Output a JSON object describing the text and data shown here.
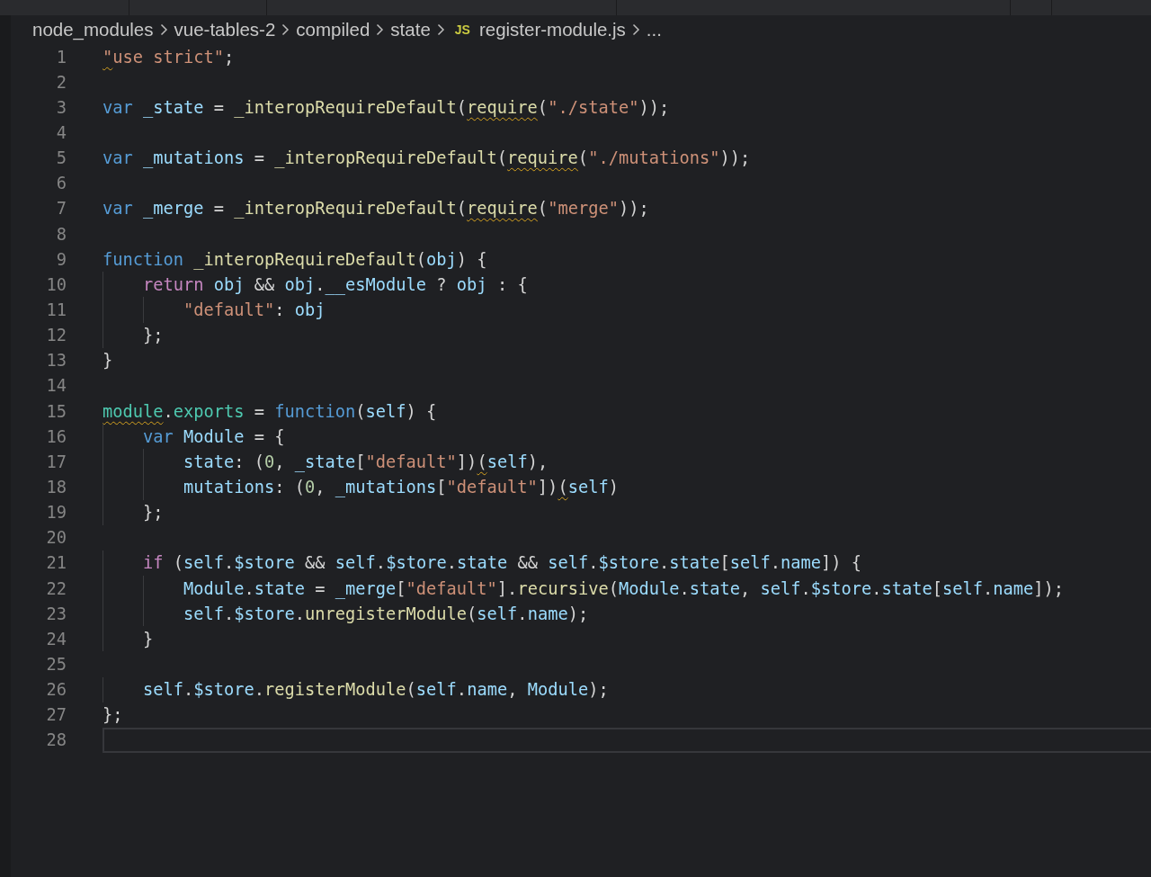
{
  "breadcrumbs": [
    {
      "kind": "folder",
      "label": "node_modules"
    },
    {
      "kind": "folder",
      "label": "vue-tables-2"
    },
    {
      "kind": "folder",
      "label": "compiled"
    },
    {
      "kind": "folder",
      "label": "state"
    },
    {
      "kind": "file",
      "badge": "JS",
      "label": "register-module.js"
    },
    {
      "kind": "more",
      "label": "..."
    }
  ],
  "lines": [
    {
      "number": "1",
      "current": false,
      "tokens": [
        {
          "text": "\"",
          "kind": "str",
          "warn": true
        },
        {
          "text": "use strict\"",
          "kind": "str"
        },
        {
          "text": ";",
          "kind": "punc"
        }
      ]
    },
    {
      "number": "2",
      "current": false
    },
    {
      "number": "3",
      "current": false,
      "tokens": [
        {
          "text": "var ",
          "kind": "kw"
        },
        {
          "text": "_state",
          "kind": "var"
        },
        {
          "text": " = ",
          "kind": "punc"
        },
        {
          "text": "_interopRequireDefault",
          "kind": "fn"
        },
        {
          "text": "(",
          "kind": "punc"
        },
        {
          "text": "require",
          "kind": "fn",
          "warn": true
        },
        {
          "text": "(",
          "kind": "punc"
        },
        {
          "text": "\"./state\"",
          "kind": "str"
        },
        {
          "text": "));",
          "kind": "punc"
        }
      ]
    },
    {
      "number": "4",
      "current": false
    },
    {
      "number": "5",
      "current": false,
      "tokens": [
        {
          "text": "var ",
          "kind": "kw"
        },
        {
          "text": "_mutations",
          "kind": "var"
        },
        {
          "text": " = ",
          "kind": "punc"
        },
        {
          "text": "_interopRequireDefault",
          "kind": "fn"
        },
        {
          "text": "(",
          "kind": "punc"
        },
        {
          "text": "require",
          "kind": "fn",
          "warn": true
        },
        {
          "text": "(",
          "kind": "punc"
        },
        {
          "text": "\"./mutations\"",
          "kind": "str"
        },
        {
          "text": "));",
          "kind": "punc"
        }
      ]
    },
    {
      "number": "6",
      "current": false
    },
    {
      "number": "7",
      "current": false,
      "tokens": [
        {
          "text": "var ",
          "kind": "kw"
        },
        {
          "text": "_merge",
          "kind": "var"
        },
        {
          "text": " = ",
          "kind": "punc"
        },
        {
          "text": "_interopRequireDefault",
          "kind": "fn"
        },
        {
          "text": "(",
          "kind": "punc"
        },
        {
          "text": "require",
          "kind": "fn",
          "warn": true
        },
        {
          "text": "(",
          "kind": "punc"
        },
        {
          "text": "\"merge\"",
          "kind": "str"
        },
        {
          "text": "));",
          "kind": "punc"
        }
      ]
    },
    {
      "number": "8",
      "current": false
    },
    {
      "number": "9",
      "current": false,
      "tokens": [
        {
          "text": "function ",
          "kind": "kw"
        },
        {
          "text": "_interopRequireDefault",
          "kind": "fn"
        },
        {
          "text": "(",
          "kind": "punc"
        },
        {
          "text": "obj",
          "kind": "var"
        },
        {
          "text": ") {",
          "kind": "punc"
        }
      ]
    },
    {
      "number": "10",
      "current": false,
      "tokens": [
        {
          "text": "    return ",
          "kind": "ctl"
        },
        {
          "text": "obj",
          "kind": "var"
        },
        {
          "text": " && ",
          "kind": "punc"
        },
        {
          "text": "obj",
          "kind": "var"
        },
        {
          "text": ".",
          "kind": "punc"
        },
        {
          "text": "__esModule",
          "kind": "var"
        },
        {
          "text": " ? ",
          "kind": "punc"
        },
        {
          "text": "obj",
          "kind": "var"
        },
        {
          "text": " : {",
          "kind": "punc"
        }
      ]
    },
    {
      "number": "11",
      "current": false,
      "tokens": [
        {
          "text": "        \"default\"",
          "kind": "str"
        },
        {
          "text": ": ",
          "kind": "punc"
        },
        {
          "text": "obj",
          "kind": "var"
        }
      ]
    },
    {
      "number": "12",
      "current": false,
      "tokens": [
        {
          "text": "    };",
          "kind": "punc"
        }
      ]
    },
    {
      "number": "13",
      "current": false,
      "tokens": [
        {
          "text": "}",
          "kind": "punc"
        }
      ]
    },
    {
      "number": "14",
      "current": false
    },
    {
      "number": "15",
      "current": false,
      "tokens": [
        {
          "text": "module",
          "kind": "type",
          "warn": true
        },
        {
          "text": ".",
          "kind": "punc"
        },
        {
          "text": "exports",
          "kind": "type"
        },
        {
          "text": " = ",
          "kind": "punc"
        },
        {
          "text": "function",
          "kind": "kw"
        },
        {
          "text": "(",
          "kind": "punc"
        },
        {
          "text": "self",
          "kind": "var"
        },
        {
          "text": ") {",
          "kind": "punc"
        }
      ]
    },
    {
      "number": "16",
      "current": false,
      "tokens": [
        {
          "text": "    var ",
          "kind": "kw"
        },
        {
          "text": "Module",
          "kind": "var"
        },
        {
          "text": " = {",
          "kind": "punc"
        }
      ]
    },
    {
      "number": "17",
      "current": false,
      "tokens": [
        {
          "text": "        state",
          "kind": "var"
        },
        {
          "text": ": (",
          "kind": "punc"
        },
        {
          "text": "0",
          "kind": "num"
        },
        {
          "text": ", ",
          "kind": "punc"
        },
        {
          "text": "_state",
          "kind": "var"
        },
        {
          "text": "[",
          "kind": "punc"
        },
        {
          "text": "\"default\"",
          "kind": "str"
        },
        {
          "text": "])",
          "kind": "punc"
        },
        {
          "text": "(",
          "kind": "punc",
          "warn": true
        },
        {
          "text": "self",
          "kind": "var"
        },
        {
          "text": "),",
          "kind": "punc"
        }
      ]
    },
    {
      "number": "18",
      "current": false,
      "tokens": [
        {
          "text": "        mutations",
          "kind": "var"
        },
        {
          "text": ": (",
          "kind": "punc"
        },
        {
          "text": "0",
          "kind": "num"
        },
        {
          "text": ", ",
          "kind": "punc"
        },
        {
          "text": "_mutations",
          "kind": "var"
        },
        {
          "text": "[",
          "kind": "punc"
        },
        {
          "text": "\"default\"",
          "kind": "str"
        },
        {
          "text": "])",
          "kind": "punc"
        },
        {
          "text": "(",
          "kind": "punc",
          "warn": true
        },
        {
          "text": "self",
          "kind": "var"
        },
        {
          "text": ")",
          "kind": "punc"
        }
      ]
    },
    {
      "number": "19",
      "current": false,
      "tokens": [
        {
          "text": "    };",
          "kind": "punc"
        }
      ]
    },
    {
      "number": "20",
      "current": false
    },
    {
      "number": "21",
      "current": false,
      "tokens": [
        {
          "text": "    if",
          "kind": "ctl"
        },
        {
          "text": " (",
          "kind": "punc"
        },
        {
          "text": "self",
          "kind": "var"
        },
        {
          "text": ".",
          "kind": "punc"
        },
        {
          "text": "$store",
          "kind": "var"
        },
        {
          "text": " && ",
          "kind": "punc"
        },
        {
          "text": "self",
          "kind": "var"
        },
        {
          "text": ".",
          "kind": "punc"
        },
        {
          "text": "$store",
          "kind": "var"
        },
        {
          "text": ".",
          "kind": "punc"
        },
        {
          "text": "state",
          "kind": "var"
        },
        {
          "text": " && ",
          "kind": "punc"
        },
        {
          "text": "self",
          "kind": "var"
        },
        {
          "text": ".",
          "kind": "punc"
        },
        {
          "text": "$store",
          "kind": "var"
        },
        {
          "text": ".",
          "kind": "punc"
        },
        {
          "text": "state",
          "kind": "var"
        },
        {
          "text": "[",
          "kind": "punc"
        },
        {
          "text": "self",
          "kind": "var"
        },
        {
          "text": ".",
          "kind": "punc"
        },
        {
          "text": "name",
          "kind": "var"
        },
        {
          "text": "]) {",
          "kind": "punc"
        }
      ]
    },
    {
      "number": "22",
      "current": false,
      "tokens": [
        {
          "text": "        Module",
          "kind": "var"
        },
        {
          "text": ".",
          "kind": "punc"
        },
        {
          "text": "state",
          "kind": "var"
        },
        {
          "text": " = ",
          "kind": "punc"
        },
        {
          "text": "_merge",
          "kind": "var"
        },
        {
          "text": "[",
          "kind": "punc"
        },
        {
          "text": "\"default\"",
          "kind": "str"
        },
        {
          "text": "].",
          "kind": "punc"
        },
        {
          "text": "recursive",
          "kind": "fn"
        },
        {
          "text": "(",
          "kind": "punc"
        },
        {
          "text": "Module",
          "kind": "var"
        },
        {
          "text": ".",
          "kind": "punc"
        },
        {
          "text": "state",
          "kind": "var"
        },
        {
          "text": ", ",
          "kind": "punc"
        },
        {
          "text": "self",
          "kind": "var"
        },
        {
          "text": ".",
          "kind": "punc"
        },
        {
          "text": "$store",
          "kind": "var"
        },
        {
          "text": ".",
          "kind": "punc"
        },
        {
          "text": "state",
          "kind": "var"
        },
        {
          "text": "[",
          "kind": "punc"
        },
        {
          "text": "self",
          "kind": "var"
        },
        {
          "text": ".",
          "kind": "punc"
        },
        {
          "text": "name",
          "kind": "var"
        },
        {
          "text": "]);",
          "kind": "punc"
        }
      ]
    },
    {
      "number": "23",
      "current": false,
      "tokens": [
        {
          "text": "        self",
          "kind": "var"
        },
        {
          "text": ".",
          "kind": "punc"
        },
        {
          "text": "$store",
          "kind": "var"
        },
        {
          "text": ".",
          "kind": "punc"
        },
        {
          "text": "unregisterModule",
          "kind": "fn"
        },
        {
          "text": "(",
          "kind": "punc"
        },
        {
          "text": "self",
          "kind": "var"
        },
        {
          "text": ".",
          "kind": "punc"
        },
        {
          "text": "name",
          "kind": "var"
        },
        {
          "text": ");",
          "kind": "punc"
        }
      ]
    },
    {
      "number": "24",
      "current": false,
      "tokens": [
        {
          "text": "    }",
          "kind": "punc"
        }
      ]
    },
    {
      "number": "25",
      "current": false
    },
    {
      "number": "26",
      "current": false,
      "tokens": [
        {
          "text": "    self",
          "kind": "var"
        },
        {
          "text": ".",
          "kind": "punc"
        },
        {
          "text": "$store",
          "kind": "var"
        },
        {
          "text": ".",
          "kind": "punc"
        },
        {
          "text": "registerModule",
          "kind": "fn"
        },
        {
          "text": "(",
          "kind": "punc"
        },
        {
          "text": "self",
          "kind": "var"
        },
        {
          "text": ".",
          "kind": "punc"
        },
        {
          "text": "name",
          "kind": "var"
        },
        {
          "text": ", ",
          "kind": "punc"
        },
        {
          "text": "Module",
          "kind": "var"
        },
        {
          "text": ");",
          "kind": "punc"
        }
      ]
    },
    {
      "number": "27",
      "current": false,
      "tokens": [
        {
          "text": "};",
          "kind": "punc"
        }
      ]
    },
    {
      "number": "28",
      "current": true
    }
  ]
}
